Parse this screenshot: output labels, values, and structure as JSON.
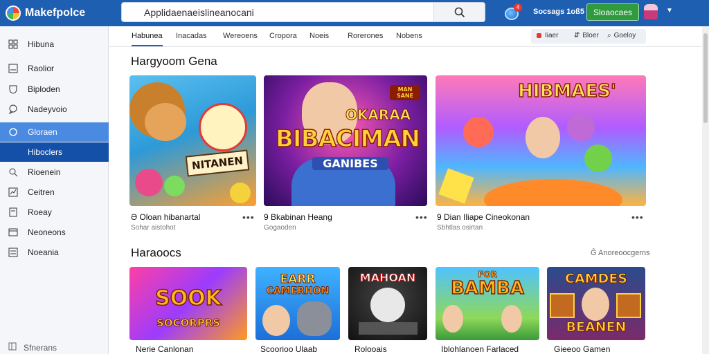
{
  "app": {
    "title": "Makefpolce"
  },
  "search": {
    "value": "Applidaenaeislineanocani"
  },
  "header": {
    "cart_badge": "4",
    "account_label": "Socsags 1oß5",
    "action_button": "Sloaocaes"
  },
  "sidebar": {
    "items": [
      {
        "label": "Hibuna",
        "icon": "grid-icon"
      },
      {
        "label": "Raolior",
        "icon": "box-icon"
      },
      {
        "label": "Biploden",
        "icon": "shield-icon"
      },
      {
        "label": "Nadeyvoio",
        "icon": "chat-icon"
      },
      {
        "label": "Gloraen",
        "icon": "circle-icon"
      },
      {
        "label": "Hiboclers",
        "icon": "square-icon"
      },
      {
        "label": "Rioenein",
        "icon": "search-icon"
      },
      {
        "label": "Ceitren",
        "icon": "chart-icon"
      },
      {
        "label": "Roeay",
        "icon": "doc-icon"
      },
      {
        "label": "Neoneons",
        "icon": "window-icon"
      },
      {
        "label": "Noeania",
        "icon": "list-icon"
      }
    ],
    "footer": "Sfnerans"
  },
  "tabs": [
    "Habunea",
    "Inacadas",
    "Wereoens",
    "Cropora",
    "Noeis",
    "Rorerones",
    "Nobens"
  ],
  "toolbar": {
    "items": [
      "Iiaer",
      "Bloer",
      "Goeloy"
    ]
  },
  "section1": {
    "title": "Hargyoom Gena",
    "cards": [
      {
        "title": "Ə Oloan hibanartal",
        "sub": "Sohar aistohot",
        "art_text": "NITANEN"
      },
      {
        "title": "9 Bkabinan Heang",
        "sub": "Gogaoden",
        "art_text": "BIBACIMAN",
        "art_top": "OKARAA",
        "art_bottom": "GANIBES",
        "art_badge": "MAN SANE"
      },
      {
        "title": "9 Dian Iliape Cineokonan",
        "sub": "Sbhtlas osirtan",
        "art_text": "HIBMAES'"
      }
    ]
  },
  "section2": {
    "title": "Haraoocs",
    "see_more": "Ĝ Anoreoocgerns",
    "cards": [
      {
        "caption": "Nerie Canlonan",
        "art_text": "SOOK",
        "art_sub": "SOCORPRS"
      },
      {
        "caption": "Scoorioo Ulaab",
        "art_text": "EARR",
        "art_sub": "CAMERHON"
      },
      {
        "caption": "Rolooais",
        "art_text": "MAHOAN"
      },
      {
        "caption": "Iblohlanoen Farlaced",
        "art_text": "BAMBA",
        "art_top": "FOR"
      },
      {
        "caption": "Gieeoo Gamen",
        "art_text": "CAMDES",
        "art_sub": "BEANEN"
      }
    ]
  }
}
